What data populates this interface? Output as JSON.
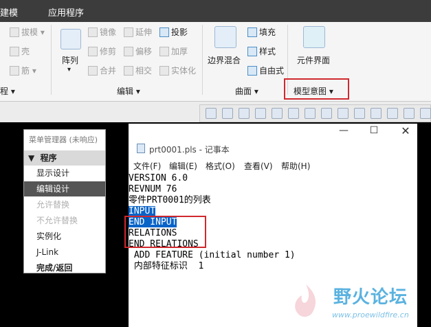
{
  "tabs": [
    {
      "label": "建模"
    },
    {
      "label": "应用程序"
    }
  ],
  "ribbon": {
    "left_partial": [
      {
        "label": "拔模"
      },
      {
        "label": "壳"
      },
      {
        "label": "筋"
      }
    ],
    "left_group_label": "程",
    "pattern": {
      "label": "阵列"
    },
    "edit_items": [
      {
        "label": "镜像"
      },
      {
        "label": "延伸"
      },
      {
        "label": "投影"
      },
      {
        "label": "修剪"
      },
      {
        "label": "偏移"
      },
      {
        "label": "加厚"
      },
      {
        "label": "合并"
      },
      {
        "label": "相交"
      },
      {
        "label": "实体化"
      }
    ],
    "edit_group_label": "编辑",
    "surface": {
      "blend_label": "边界混合",
      "items": [
        {
          "label": "填充"
        },
        {
          "label": "样式"
        },
        {
          "label": "自由式"
        }
      ],
      "group_label": "曲面"
    },
    "model_intent": {
      "component_interface_label": "元件界面",
      "group_label": "模型意图"
    }
  },
  "menu_manager": {
    "title": "菜单管理器 (未响应)",
    "header": "程序",
    "items": [
      {
        "label": "显示设计",
        "enabled": true,
        "selected": false
      },
      {
        "label": "编辑设计",
        "enabled": true,
        "selected": true
      },
      {
        "label": "允许替换",
        "enabled": false,
        "selected": false
      },
      {
        "label": "不允许替换",
        "enabled": false,
        "selected": false
      },
      {
        "label": "实例化",
        "enabled": true,
        "selected": false
      },
      {
        "label": "J-Link",
        "enabled": true,
        "selected": false
      },
      {
        "label": "完成/返回",
        "enabled": true,
        "selected": false
      }
    ]
  },
  "notepad": {
    "title": "prt0001.pls - 记事本",
    "menu": [
      {
        "label": "文件(F)"
      },
      {
        "label": "编辑(E)"
      },
      {
        "label": "格式(O)"
      },
      {
        "label": "查看(V)"
      },
      {
        "label": "帮助(H)"
      }
    ],
    "lines": [
      "VERSION 6.0",
      "REVNUM 76",
      "零件PRT0001的列表",
      "",
      "INPUT",
      "END INPUT",
      "",
      "RELATIONS",
      "END RELATIONS",
      "",
      "",
      " ADD FEATURE (initial number 1)",
      " 内部特征标识  1"
    ]
  },
  "watermark": {
    "title": "野火论坛",
    "url": "www.proewildfire.cn"
  },
  "colors": {
    "highlight": "#0a64c8",
    "callout": "#d0282e",
    "watermark": "#5ab2e0"
  }
}
